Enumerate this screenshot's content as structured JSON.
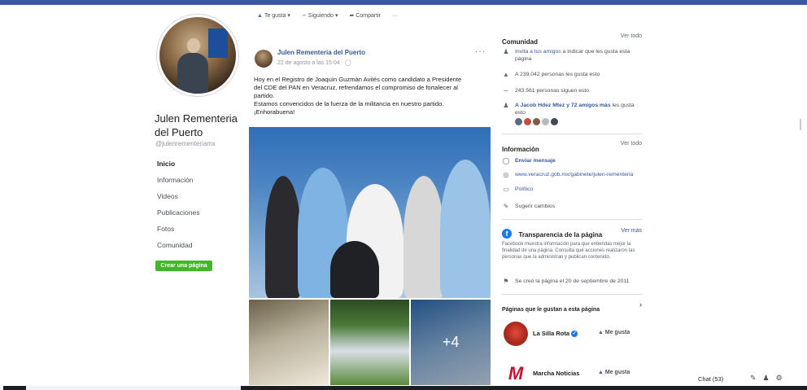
{
  "page": {
    "name": "Julen Rementeria del Puerto",
    "handle": "@julenrementeriamx"
  },
  "left_nav": {
    "items": [
      "Inicio",
      "Información",
      "Videos",
      "Publicaciones",
      "Fotos",
      "Comunidad"
    ],
    "create_page_label": "Crear una página"
  },
  "action_bar": {
    "like_label": "Te gusta",
    "following_label": "Siguiendo",
    "share_label": "Compartir",
    "more_label": "···"
  },
  "post": {
    "author": "Julen Rementeria del Puerto",
    "date": "22 de agosto a las 15:04 ·",
    "more": "···",
    "text_lines": [
      "Hoy en el Registro de Joaquín Guzmán Avilés como candidato a Presidente",
      "del CDE del PAN en Veracruz, refrendamos el compromiso de fortalecer al",
      "partido.",
      "Estamos convencidos de la fuerza de la militancia en nuestro partido.",
      "¡Enhorabuena!"
    ],
    "more_photos": "+4"
  },
  "community": {
    "title": "Comunidad",
    "see_all": "Ver todo",
    "invite_link": "Invita a tus amigos",
    "invite_rest": "a indicar que les gusta esta página",
    "likes": "A 239.042 personas les gusta esto",
    "follows": "243.561 personas siguen esto",
    "friends_link": "A Jacob Hdez Mtez y 72 amigos más",
    "friends_rest": "les gusta esto"
  },
  "info": {
    "title": "Información",
    "see_all": "Ver todo",
    "send_message": "Enviar mensaje",
    "website": "www.veracruz.gob.mx/gabinete/julen-rementeria",
    "category": "Político",
    "suggest": "Sugerir cambios"
  },
  "transparency": {
    "title": "Transparencia de la página",
    "see_more": "Ver más",
    "description": "Facebook muestra información para que entiendas mejor la finalidad de una página. Consulta qué acciones realizaron las personas que la administran y publican contenido.",
    "created": "Se creó la página el 20 de septiembre de 2011"
  },
  "liked_pages": {
    "title": "Páginas que le gustan a esta página",
    "items": [
      {
        "name": "La Silla Rota",
        "button": "Me gusta"
      },
      {
        "name": "Marcha Noticias",
        "button": "Me gusta"
      }
    ]
  },
  "chat": {
    "label": "Chat (53)"
  },
  "colors": {
    "brand": "#3b5998",
    "link": "#385898",
    "create_button": "#42b72a"
  }
}
